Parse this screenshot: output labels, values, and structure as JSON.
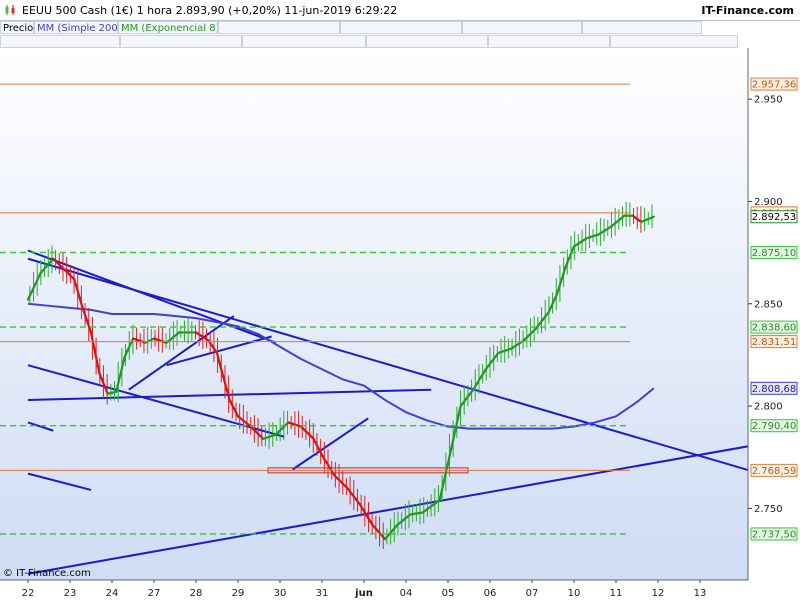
{
  "header": {
    "title": "EEUU 500 Cash (1€)   1 hora   2.893,90 (+0,20%)   11-jun-2019 6:29:22",
    "source": "IT-Finance.com"
  },
  "legend": {
    "price": "Precio",
    "sma": "MM (Simple 200)",
    "ema": "MM (Exponencial 8)"
  },
  "footer": {
    "copyright": "© IT-Finance.com"
  },
  "colors": {
    "background_top": "#ffffff",
    "background_bottom": "#cfdcf4",
    "price_up": "#2eaa2e",
    "price_down": "#dd2222",
    "sma": "#3f3fd8",
    "ema_up": "#1f9a1f",
    "ema_down": "#e01010",
    "trendline": "#1a1ad0",
    "resistance": "#e07a3a",
    "support": "#2ecc2e"
  },
  "chart_data": {
    "type": "line",
    "x": [
      "22",
      "23",
      "24",
      "27",
      "28",
      "29",
      "30",
      "31",
      "jun",
      "04",
      "05",
      "06",
      "07",
      "10",
      "11",
      "12",
      "13"
    ],
    "ylim": [
      2.715,
      2.975
    ],
    "y_ticks": [
      "2.950",
      "2.900",
      "2.850",
      "2.800",
      "2.750"
    ],
    "levels": [
      {
        "label": "2.957,36",
        "value": 2.95736,
        "style": "resistance"
      },
      {
        "label": "2.894,43",
        "value": 2.89443,
        "style": "resistance"
      },
      {
        "label": "2.892,53",
        "value": 2.89253,
        "style": "last"
      },
      {
        "label": "2.875,10",
        "value": 2.8751,
        "style": "support"
      },
      {
        "label": "2.838,60",
        "value": 2.8386,
        "style": "support"
      },
      {
        "label": "2.831,51",
        "value": 2.83151,
        "style": "resistance"
      },
      {
        "label": "2.808,68",
        "value": 2.80868,
        "style": "sma"
      },
      {
        "label": "2.790,40",
        "value": 2.7904,
        "style": "support"
      },
      {
        "label": "2.768,59",
        "value": 2.76859,
        "style": "resistance"
      },
      {
        "label": "2.737,50",
        "value": 2.7375,
        "style": "support"
      }
    ],
    "price_path": [
      [
        0,
        2.852
      ],
      [
        0.3,
        2.865
      ],
      [
        0.6,
        2.872
      ],
      [
        0.9,
        2.866
      ],
      [
        1.1,
        2.862
      ],
      [
        1.3,
        2.848
      ],
      [
        1.5,
        2.836
      ],
      [
        1.7,
        2.816
      ],
      [
        1.9,
        2.806
      ],
      [
        2.1,
        2.807
      ],
      [
        2.3,
        2.824
      ],
      [
        2.5,
        2.833
      ],
      [
        2.8,
        2.831
      ],
      [
        3.0,
        2.833
      ],
      [
        3.3,
        2.831
      ],
      [
        3.6,
        2.836
      ],
      [
        4.0,
        2.836
      ],
      [
        4.3,
        2.832
      ],
      [
        4.5,
        2.826
      ],
      [
        4.6,
        2.818
      ],
      [
        4.8,
        2.803
      ],
      [
        5.0,
        2.795
      ],
      [
        5.3,
        2.79
      ],
      [
        5.6,
        2.784
      ],
      [
        5.9,
        2.786
      ],
      [
        6.2,
        2.792
      ],
      [
        6.5,
        2.79
      ],
      [
        6.8,
        2.784
      ],
      [
        7.0,
        2.776
      ],
      [
        7.3,
        2.766
      ],
      [
        7.6,
        2.76
      ],
      [
        7.9,
        2.752
      ],
      [
        8.2,
        2.742
      ],
      [
        8.5,
        2.735
      ],
      [
        8.8,
        2.742
      ],
      [
        9.1,
        2.747
      ],
      [
        9.4,
        2.748
      ],
      [
        9.8,
        2.754
      ],
      [
        10.0,
        2.772
      ],
      [
        10.3,
        2.8
      ],
      [
        10.6,
        2.808
      ],
      [
        10.9,
        2.818
      ],
      [
        11.2,
        2.826
      ],
      [
        11.5,
        2.828
      ],
      [
        11.8,
        2.832
      ],
      [
        12.1,
        2.838
      ],
      [
        12.4,
        2.846
      ],
      [
        12.6,
        2.855
      ],
      [
        12.8,
        2.868
      ],
      [
        13.0,
        2.878
      ],
      [
        13.3,
        2.882
      ],
      [
        13.6,
        2.884
      ],
      [
        13.9,
        2.888
      ],
      [
        14.2,
        2.893
      ],
      [
        14.4,
        2.893
      ],
      [
        14.6,
        2.89
      ],
      [
        14.9,
        2.8925
      ]
    ],
    "sma_path": [
      [
        0,
        2.85
      ],
      [
        0.5,
        2.849
      ],
      [
        1.0,
        2.848
      ],
      [
        1.5,
        2.847
      ],
      [
        2.0,
        2.845
      ],
      [
        2.5,
        2.845
      ],
      [
        3.0,
        2.845
      ],
      [
        3.5,
        2.844
      ],
      [
        4.0,
        2.843
      ],
      [
        4.5,
        2.841
      ],
      [
        5.0,
        2.839
      ],
      [
        5.5,
        2.835
      ],
      [
        6.0,
        2.829
      ],
      [
        6.5,
        2.823
      ],
      [
        7.0,
        2.818
      ],
      [
        7.5,
        2.813
      ],
      [
        8.0,
        2.81
      ],
      [
        8.5,
        2.803
      ],
      [
        9.0,
        2.797
      ],
      [
        9.5,
        2.793
      ],
      [
        10.0,
        2.79
      ],
      [
        10.5,
        2.789
      ],
      [
        11.0,
        2.789
      ],
      [
        11.5,
        2.789
      ],
      [
        12.0,
        2.789
      ],
      [
        12.5,
        2.789
      ],
      [
        13.0,
        2.79
      ],
      [
        13.5,
        2.792
      ],
      [
        14.0,
        2.795
      ],
      [
        14.5,
        2.802
      ],
      [
        14.9,
        2.8087
      ]
    ],
    "trendlines": [
      [
        [
          0,
          2.876
        ],
        [
          5.9,
          2.831
        ]
      ],
      [
        [
          0,
          2.872
        ],
        [
          17.6,
          2.766
        ]
      ],
      [
        [
          0,
          2.82
        ],
        [
          6.1,
          2.785
        ]
      ],
      [
        [
          0,
          2.803
        ],
        [
          9.6,
          2.808
        ]
      ],
      [
        [
          0,
          2.718
        ],
        [
          17.6,
          2.782
        ]
      ],
      [
        [
          0,
          2.792
        ],
        [
          0.6,
          2.788
        ]
      ],
      [
        [
          0,
          2.767
        ],
        [
          1.5,
          2.759
        ]
      ],
      [
        [
          2.4,
          2.808
        ],
        [
          4.9,
          2.844
        ]
      ],
      [
        [
          3.3,
          2.82
        ],
        [
          5.8,
          2.834
        ]
      ],
      [
        [
          6.3,
          2.769
        ],
        [
          8.1,
          2.794
        ]
      ]
    ]
  }
}
